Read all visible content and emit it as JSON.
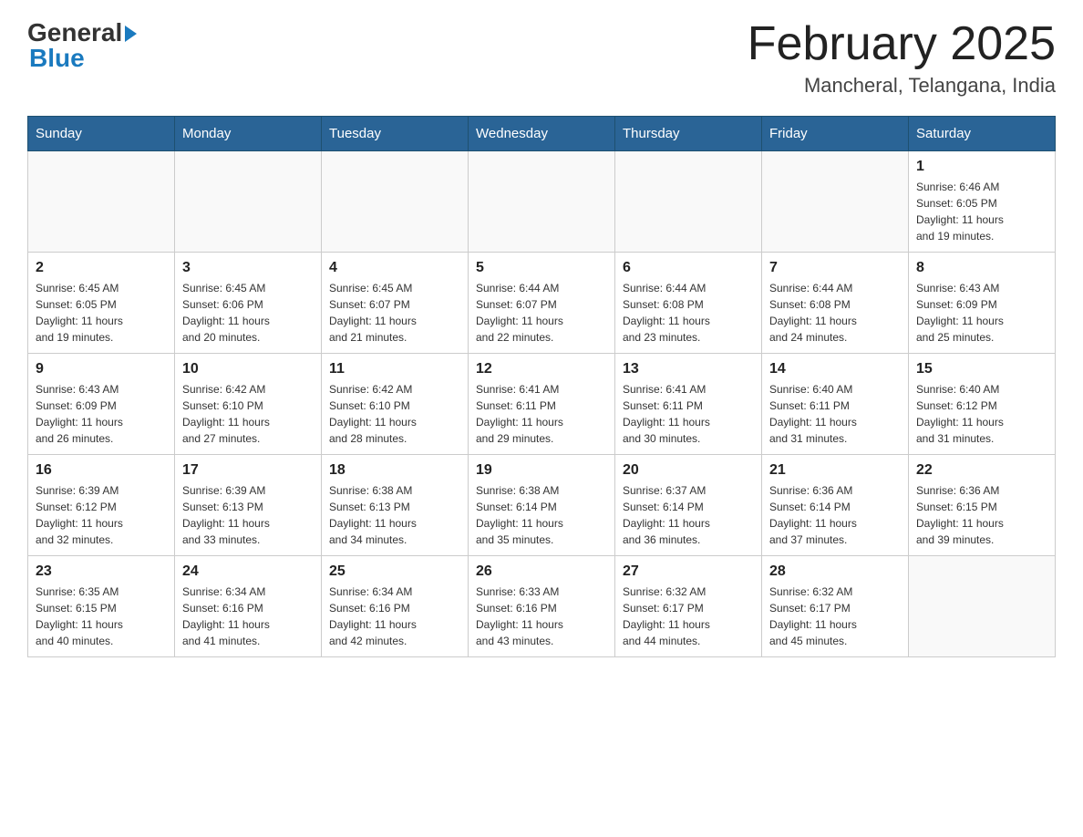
{
  "header": {
    "logo_general": "General",
    "logo_blue": "Blue",
    "month_year": "February 2025",
    "location": "Mancheral, Telangana, India"
  },
  "days_of_week": [
    "Sunday",
    "Monday",
    "Tuesday",
    "Wednesday",
    "Thursday",
    "Friday",
    "Saturday"
  ],
  "weeks": [
    {
      "cells": [
        {
          "day": "",
          "info": ""
        },
        {
          "day": "",
          "info": ""
        },
        {
          "day": "",
          "info": ""
        },
        {
          "day": "",
          "info": ""
        },
        {
          "day": "",
          "info": ""
        },
        {
          "day": "",
          "info": ""
        },
        {
          "day": "1",
          "info": "Sunrise: 6:46 AM\nSunset: 6:05 PM\nDaylight: 11 hours\nand 19 minutes."
        }
      ]
    },
    {
      "cells": [
        {
          "day": "2",
          "info": "Sunrise: 6:45 AM\nSunset: 6:05 PM\nDaylight: 11 hours\nand 19 minutes."
        },
        {
          "day": "3",
          "info": "Sunrise: 6:45 AM\nSunset: 6:06 PM\nDaylight: 11 hours\nand 20 minutes."
        },
        {
          "day": "4",
          "info": "Sunrise: 6:45 AM\nSunset: 6:07 PM\nDaylight: 11 hours\nand 21 minutes."
        },
        {
          "day": "5",
          "info": "Sunrise: 6:44 AM\nSunset: 6:07 PM\nDaylight: 11 hours\nand 22 minutes."
        },
        {
          "day": "6",
          "info": "Sunrise: 6:44 AM\nSunset: 6:08 PM\nDaylight: 11 hours\nand 23 minutes."
        },
        {
          "day": "7",
          "info": "Sunrise: 6:44 AM\nSunset: 6:08 PM\nDaylight: 11 hours\nand 24 minutes."
        },
        {
          "day": "8",
          "info": "Sunrise: 6:43 AM\nSunset: 6:09 PM\nDaylight: 11 hours\nand 25 minutes."
        }
      ]
    },
    {
      "cells": [
        {
          "day": "9",
          "info": "Sunrise: 6:43 AM\nSunset: 6:09 PM\nDaylight: 11 hours\nand 26 minutes."
        },
        {
          "day": "10",
          "info": "Sunrise: 6:42 AM\nSunset: 6:10 PM\nDaylight: 11 hours\nand 27 minutes."
        },
        {
          "day": "11",
          "info": "Sunrise: 6:42 AM\nSunset: 6:10 PM\nDaylight: 11 hours\nand 28 minutes."
        },
        {
          "day": "12",
          "info": "Sunrise: 6:41 AM\nSunset: 6:11 PM\nDaylight: 11 hours\nand 29 minutes."
        },
        {
          "day": "13",
          "info": "Sunrise: 6:41 AM\nSunset: 6:11 PM\nDaylight: 11 hours\nand 30 minutes."
        },
        {
          "day": "14",
          "info": "Sunrise: 6:40 AM\nSunset: 6:11 PM\nDaylight: 11 hours\nand 31 minutes."
        },
        {
          "day": "15",
          "info": "Sunrise: 6:40 AM\nSunset: 6:12 PM\nDaylight: 11 hours\nand 31 minutes."
        }
      ]
    },
    {
      "cells": [
        {
          "day": "16",
          "info": "Sunrise: 6:39 AM\nSunset: 6:12 PM\nDaylight: 11 hours\nand 32 minutes."
        },
        {
          "day": "17",
          "info": "Sunrise: 6:39 AM\nSunset: 6:13 PM\nDaylight: 11 hours\nand 33 minutes."
        },
        {
          "day": "18",
          "info": "Sunrise: 6:38 AM\nSunset: 6:13 PM\nDaylight: 11 hours\nand 34 minutes."
        },
        {
          "day": "19",
          "info": "Sunrise: 6:38 AM\nSunset: 6:14 PM\nDaylight: 11 hours\nand 35 minutes."
        },
        {
          "day": "20",
          "info": "Sunrise: 6:37 AM\nSunset: 6:14 PM\nDaylight: 11 hours\nand 36 minutes."
        },
        {
          "day": "21",
          "info": "Sunrise: 6:36 AM\nSunset: 6:14 PM\nDaylight: 11 hours\nand 37 minutes."
        },
        {
          "day": "22",
          "info": "Sunrise: 6:36 AM\nSunset: 6:15 PM\nDaylight: 11 hours\nand 39 minutes."
        }
      ]
    },
    {
      "cells": [
        {
          "day": "23",
          "info": "Sunrise: 6:35 AM\nSunset: 6:15 PM\nDaylight: 11 hours\nand 40 minutes."
        },
        {
          "day": "24",
          "info": "Sunrise: 6:34 AM\nSunset: 6:16 PM\nDaylight: 11 hours\nand 41 minutes."
        },
        {
          "day": "25",
          "info": "Sunrise: 6:34 AM\nSunset: 6:16 PM\nDaylight: 11 hours\nand 42 minutes."
        },
        {
          "day": "26",
          "info": "Sunrise: 6:33 AM\nSunset: 6:16 PM\nDaylight: 11 hours\nand 43 minutes."
        },
        {
          "day": "27",
          "info": "Sunrise: 6:32 AM\nSunset: 6:17 PM\nDaylight: 11 hours\nand 44 minutes."
        },
        {
          "day": "28",
          "info": "Sunrise: 6:32 AM\nSunset: 6:17 PM\nDaylight: 11 hours\nand 45 minutes."
        },
        {
          "day": "",
          "info": ""
        }
      ]
    }
  ]
}
